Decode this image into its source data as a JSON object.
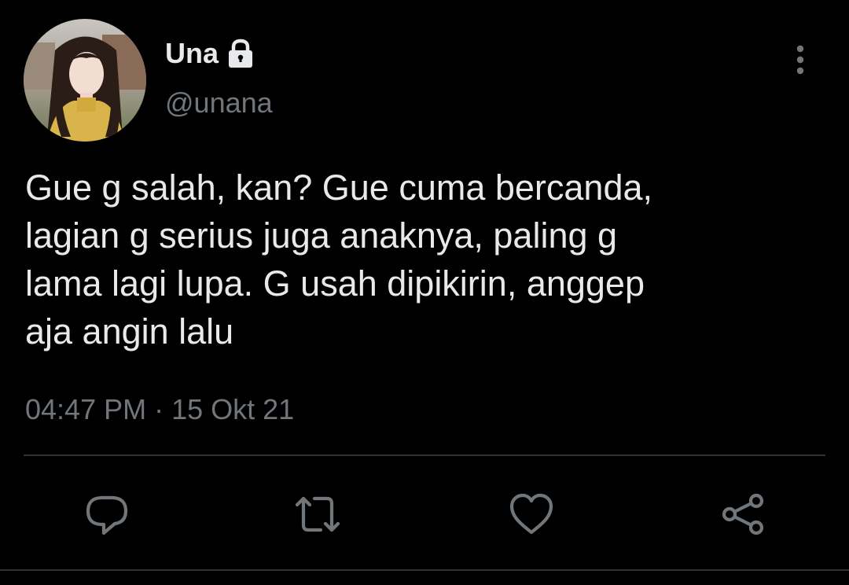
{
  "tweet": {
    "display_name": "Una",
    "handle": "@unana",
    "text": "Gue g salah, kan? Gue cuma bercanda,\nlagian g serius juga anaknya, paling g\nlama lagi lupa. G usah dipikirin, anggep\naja angin lalu",
    "time": "04:47 PM",
    "separator": "·",
    "date": "15 Okt 21"
  },
  "icons": {
    "lock": "lock-icon",
    "more": "more-vertical-icon",
    "reply": "reply-icon",
    "retweet": "retweet-icon",
    "like": "heart-icon",
    "share": "share-icon"
  },
  "colors": {
    "background": "#000000",
    "primary_text": "#e7e9ea",
    "secondary_text": "#71767b",
    "divider": "#2f3336"
  }
}
